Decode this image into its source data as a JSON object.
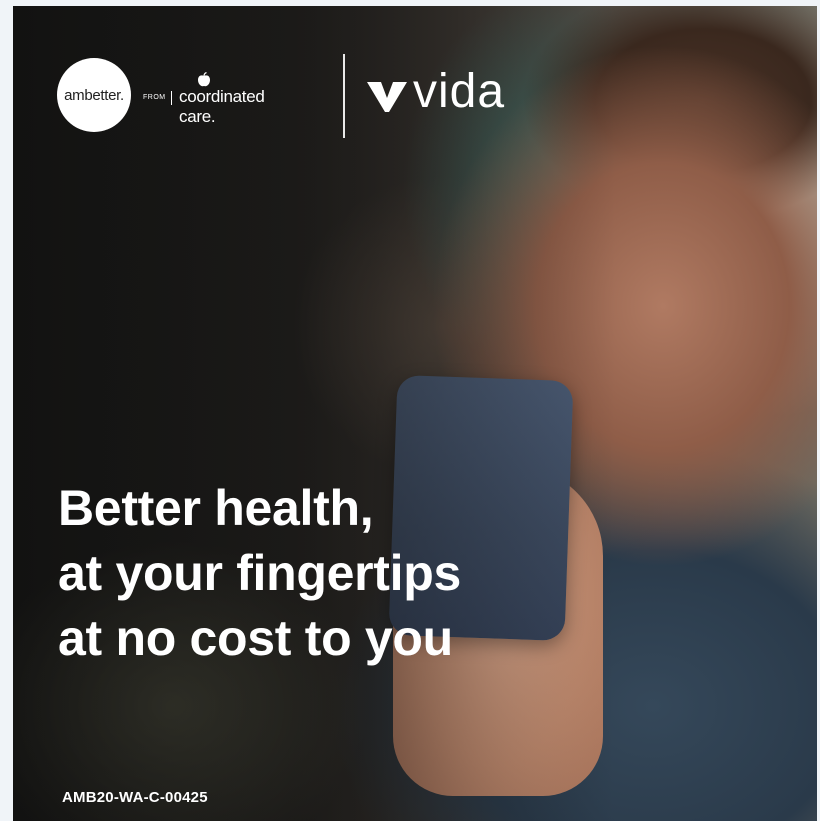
{
  "brand": {
    "ambetter": "ambetter.",
    "from": "FROM",
    "coordinated_care": "coordinated care.",
    "vida": "vida"
  },
  "headline": {
    "line1": "Better health,",
    "line2": "at your fingertips",
    "line3": "at no cost to you"
  },
  "code": "AMB20-WA-C-00425",
  "colors": {
    "text": "#ffffff",
    "logo_circle": "#ffffff",
    "phone": "#3d4b61"
  },
  "icons": [
    "apple-icon",
    "vida-checkmark-icon"
  ]
}
